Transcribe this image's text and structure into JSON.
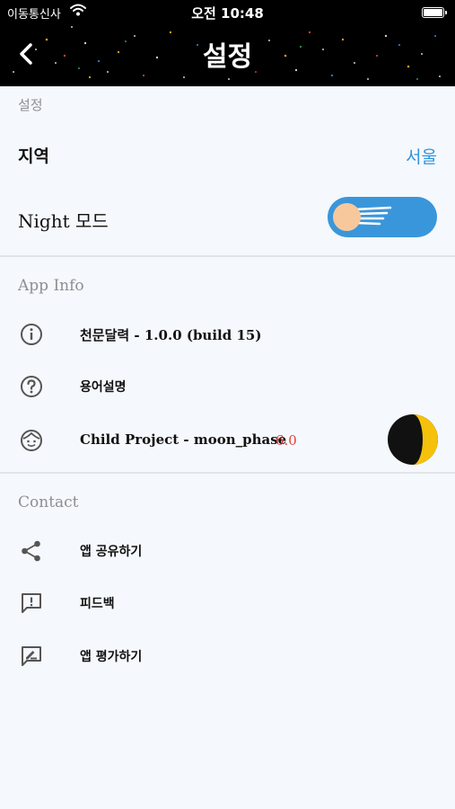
{
  "status_bar": {
    "carrier": "이동통신사",
    "time": "오전 10:48"
  },
  "header": {
    "title": "설정",
    "back_icon": "chevron-left-icon"
  },
  "settings_section": {
    "label": "설정",
    "region": {
      "label": "지역",
      "value": "서울"
    },
    "night_mode": {
      "label": "Night 모드",
      "enabled": true
    }
  },
  "app_info_section": {
    "label": "App Info",
    "items": [
      {
        "icon": "info-icon",
        "text": "천문달력 - 1.0.0 (build 15)"
      },
      {
        "icon": "help-icon",
        "text": "용어설명"
      },
      {
        "icon": "face-icon",
        "text": "Child Project - moon_phase",
        "version": "6.0"
      }
    ]
  },
  "contact_section": {
    "label": "Contact",
    "items": [
      {
        "icon": "share-icon",
        "text": "앱 공유하기"
      },
      {
        "icon": "feedback-icon",
        "text": "피드백"
      },
      {
        "icon": "rate-review-icon",
        "text": "앱 평가하기"
      }
    ]
  },
  "colors": {
    "accent": "#2f95dc",
    "toggle": "#3a96db",
    "version": "#e0403a",
    "moon_light": "#f5c10b"
  }
}
